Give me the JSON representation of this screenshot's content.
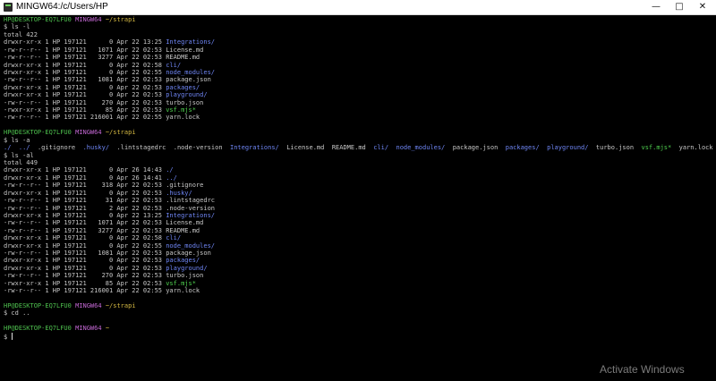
{
  "window": {
    "title": "MINGW64:/c/Users/HP",
    "minimize_glyph": "—",
    "maximize_glyph": "□",
    "close_glyph": "✕",
    "icon": "mintty-terminal-icon"
  },
  "colors": {
    "background": "#000000",
    "text": "#c8c8c8",
    "prompt_user": "#4ec14e",
    "prompt_system": "#c468d4",
    "prompt_path": "#d3b842",
    "directory": "#6f86f5",
    "executable": "#4fd04f"
  },
  "terminal": {
    "block1": {
      "prompt": {
        "user": "HP@DESKTOP-EQ7LFU0",
        "system": "MINGW64",
        "path": "~/strapi"
      },
      "command": "$ ls -l",
      "total": "total 422",
      "rows": [
        {
          "meta": "drwxr-xr-x 1 HP 197121      0 Apr 22 13:25 ",
          "name": "Integrations/"
        },
        {
          "meta": "-rw-r--r-- 1 HP 197121   1071 Apr 22 02:53 ",
          "name": "License.md"
        },
        {
          "meta": "-rw-r--r-- 1 HP 197121   3277 Apr 22 02:53 ",
          "name": "README.md"
        },
        {
          "meta": "drwxr-xr-x 1 HP 197121      0 Apr 22 02:58 ",
          "name": "cli/"
        },
        {
          "meta": "drwxr-xr-x 1 HP 197121      0 Apr 22 02:55 ",
          "name": "node_modules/"
        },
        {
          "meta": "-rw-r--r-- 1 HP 197121   1081 Apr 22 02:53 ",
          "name": "package.json"
        },
        {
          "meta": "drwxr-xr-x 1 HP 197121      0 Apr 22 02:53 ",
          "name": "packages/"
        },
        {
          "meta": "drwxr-xr-x 1 HP 197121      0 Apr 22 02:53 ",
          "name": "playground/"
        },
        {
          "meta": "-rw-r--r-- 1 HP 197121    270 Apr 22 02:53 ",
          "name": "turbo.json"
        },
        {
          "meta": "-rwxr-xr-x 1 HP 197121     85 Apr 22 02:53 ",
          "name": "vsf.mjs*"
        },
        {
          "meta": "-rw-r--r-- 1 HP 197121 216001 Apr 22 02:55 ",
          "name": "yarn.lock"
        }
      ]
    },
    "block2": {
      "prompt": {
        "user": "HP@DESKTOP-EQ7LFU0",
        "system": "MINGW64",
        "path": "~/strapi"
      },
      "command": "$ ls -a",
      "entries": [
        "./",
        "../",
        ".gitignore",
        ".husky/",
        ".lintstagedrc",
        ".node-version",
        "Integrations/",
        "License.md",
        "README.md",
        "cli/",
        "node_modules/",
        "package.json",
        "packages/",
        "playground/",
        "turbo.json",
        "vsf.mjs*",
        "yarn.lock"
      ]
    },
    "block3": {
      "command": "$ ls -al",
      "total": "total 449",
      "rows": [
        {
          "meta": "drwxr-xr-x 1 HP 197121      0 Apr 26 14:43 ",
          "name": "./"
        },
        {
          "meta": "drwxr-xr-x 1 HP 197121      0 Apr 26 14:41 ",
          "name": "../"
        },
        {
          "meta": "-rw-r--r-- 1 HP 197121    318 Apr 22 02:53 ",
          "name": ".gitignore"
        },
        {
          "meta": "drwxr-xr-x 1 HP 197121      0 Apr 22 02:53 ",
          "name": ".husky/"
        },
        {
          "meta": "-rw-r--r-- 1 HP 197121     31 Apr 22 02:53 ",
          "name": ".lintstagedrc"
        },
        {
          "meta": "-rw-r--r-- 1 HP 197121      2 Apr 22 02:53 ",
          "name": ".node-version"
        },
        {
          "meta": "drwxr-xr-x 1 HP 197121      0 Apr 22 13:25 ",
          "name": "Integrations/"
        },
        {
          "meta": "-rw-r--r-- 1 HP 197121   1071 Apr 22 02:53 ",
          "name": "License.md"
        },
        {
          "meta": "-rw-r--r-- 1 HP 197121   3277 Apr 22 02:53 ",
          "name": "README.md"
        },
        {
          "meta": "drwxr-xr-x 1 HP 197121      0 Apr 22 02:58 ",
          "name": "cli/"
        },
        {
          "meta": "drwxr-xr-x 1 HP 197121      0 Apr 22 02:55 ",
          "name": "node_modules/"
        },
        {
          "meta": "-rw-r--r-- 1 HP 197121   1081 Apr 22 02:53 ",
          "name": "package.json"
        },
        {
          "meta": "drwxr-xr-x 1 HP 197121      0 Apr 22 02:53 ",
          "name": "packages/"
        },
        {
          "meta": "drwxr-xr-x 1 HP 197121      0 Apr 22 02:53 ",
          "name": "playground/"
        },
        {
          "meta": "-rw-r--r-- 1 HP 197121    270 Apr 22 02:53 ",
          "name": "turbo.json"
        },
        {
          "meta": "-rwxr-xr-x 1 HP 197121     85 Apr 22 02:53 ",
          "name": "vsf.mjs*"
        },
        {
          "meta": "-rw-r--r-- 1 HP 197121 216001 Apr 22 02:55 ",
          "name": "yarn.lock"
        }
      ]
    },
    "block4": {
      "prompt": {
        "user": "HP@DESKTOP-EQ7LFU0",
        "system": "MINGW64",
        "path": "~/strapi"
      },
      "command": "$ cd .."
    },
    "block5": {
      "prompt": {
        "user": "HP@DESKTOP-EQ7LFU0",
        "system": "MINGW64",
        "path": "~"
      },
      "command": "$ "
    }
  },
  "watermark": "Activate Windows"
}
